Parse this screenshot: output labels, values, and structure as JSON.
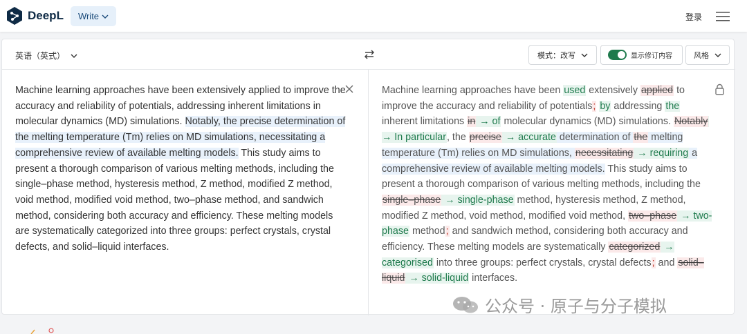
{
  "header": {
    "brand": "DeepL",
    "write_label": "Write",
    "login_label": "登录"
  },
  "toolbar": {
    "source_language": "英语（英式）",
    "mode_label": "模式：改写",
    "track_changes_label": "显示修订内容",
    "style_label": "风格"
  },
  "source_text": {
    "p1": "Machine learning approaches have been extensively applied to improve the accuracy and reliability of potentials, addressing inherent limitations in molecular dynamics (MD) simulations. ",
    "p2": "Notably, the precise determination of the melting temperature (Tm) relies on MD simulations, necessitating a comprehensive review of available melting models.",
    "p3": " This study aims to present a thorough comparison of various melting methods, including the single–phase method, hysteresis method, Z method, modified Z method, void method, modified void method, two–phase method, and sandwich method, considering both accuracy and efficiency. These melting models are systematically categorized into three groups: perfect crystals, crystal defects, and solid–liquid interfaces."
  },
  "result_text": {
    "s1": "Machine learning approaches have been ",
    "s2": "used",
    "s3": " extensively ",
    "s4": "applied",
    "s5": " to improve the accuracy and reliability of potentials",
    "s6": ";",
    "s7": " ",
    "s8": "by",
    "s9": " addressing ",
    "s10": "the",
    "s11": " inherent limitations ",
    "s12": "in",
    "s13": " → of",
    "s14": " molecular dynamics (MD) simulations. ",
    "s15": "Notably",
    "s16": " → In particular",
    "s17": ", the ",
    "s18": "precise",
    "s19": " → accurate",
    "s20": " determination of ",
    "s21": "the",
    "s22": " melting temperature (Tm) relies on MD simulations, ",
    "s23": "necessitating",
    "s24": " → requiring",
    "s25": " a comprehensive review of available melting models.",
    "s26": " This study aims to present a thorough comparison of various melting methods, including the ",
    "s27": "single–phase",
    "s28": " → single-phase",
    "s29": " method, hysteresis method, Z method, modified Z method, void method, modified void method, ",
    "s30": "two–phase",
    "s31": " → two-phase",
    "s32": " method",
    "s33": ";",
    "s34": " and sandwich method, considering both accuracy and efficiency. These melting models are systematically ",
    "s35": "categorized",
    "s36": " → categorised",
    "s37": " into three groups: perfect crystals, crystal defects",
    "s38": ";",
    "s39": " and ",
    "s40": "solid–liquid",
    "s41": " → solid-liquid",
    "s42": " interfaces."
  },
  "watermark": "公众号 · 原子与分子模拟",
  "icons": [
    "deepl-logo-icon",
    "chevron-down-icon",
    "menu-icon",
    "swap-icon",
    "toggle-switch",
    "close-icon",
    "lock-icon",
    "wechat-icon"
  ],
  "colors": {
    "brand": "#0f2b46",
    "accent_bg": "#e6f0fa",
    "insert_bg": "#e7f4ee",
    "insert_fg": "#1e7a4c",
    "delete_bg": "#fbe9e9",
    "highlight_bg": "#e8f1fb"
  }
}
